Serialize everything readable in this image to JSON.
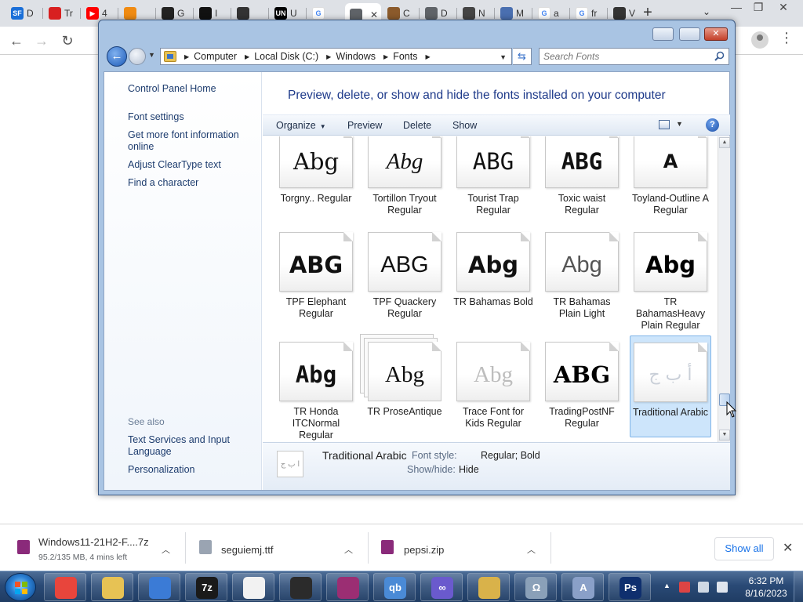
{
  "browser": {
    "tabs": [
      {
        "icon": "sf-favicon",
        "label": "SF",
        "title": "D",
        "color": "#1a6fd8"
      },
      {
        "icon": "red-favicon",
        "label": "",
        "title": "Tr",
        "color": "#d82020"
      },
      {
        "icon": "youtube-favicon",
        "label": "▶",
        "title": "4",
        "color": "#ff0000"
      },
      {
        "icon": "orange-favicon",
        "label": "",
        "title": "",
        "color": "#f08b12"
      },
      {
        "icon": "github-favicon",
        "label": "",
        "title": "G",
        "color": "#222222"
      },
      {
        "icon": "bracket-favicon",
        "label": "",
        "title": "I",
        "color": "#111111"
      },
      {
        "icon": "grid-favicon",
        "label": "",
        "title": "",
        "color": "#333333"
      },
      {
        "icon": "un-favicon",
        "label": "UN",
        "title": "U",
        "color": "#000000"
      },
      {
        "icon": "google-favicon",
        "label": "G",
        "title": "",
        "color": "#ffffff"
      },
      {
        "icon": "globe-favicon",
        "label": "",
        "title": "",
        "color": "#5f6368"
      },
      {
        "icon": "coffee-favicon",
        "label": "",
        "title": "C",
        "color": "#8b5a2b"
      },
      {
        "icon": "globe-favicon-2",
        "label": "",
        "title": "D",
        "color": "#5f6368"
      },
      {
        "icon": "openai-favicon",
        "label": "",
        "title": "N",
        "color": "#444444"
      },
      {
        "icon": "site-favicon",
        "label": "",
        "title": "M",
        "color": "#4a6fb0"
      },
      {
        "icon": "google-favicon-2",
        "label": "G",
        "title": "a",
        "color": "#ffffff"
      },
      {
        "icon": "google-favicon-3",
        "label": "G",
        "title": "fr",
        "color": "#ffffff"
      },
      {
        "icon": "museum-favicon",
        "label": "",
        "title": "V",
        "color": "#333333"
      }
    ],
    "new_tab": "+"
  },
  "explorer": {
    "breadcrumb": [
      "Computer",
      "Local Disk (C:)",
      "Windows",
      "Fonts"
    ],
    "search_placeholder": "Search Fonts",
    "nav_links": {
      "home": "Control Panel Home",
      "font_settings": "Font settings",
      "more_info": "Get more font information online",
      "cleartype": "Adjust ClearType text",
      "find_char": "Find a character"
    },
    "see_also": {
      "label": "See also",
      "text_services": "Text Services and Input Language",
      "personalization": "Personalization"
    },
    "heading": "Preview, delete, or show and hide the fonts installed on your computer",
    "commands": {
      "organize": "Organize",
      "preview": "Preview",
      "delete": "Delete",
      "show": "Show"
    },
    "fonts": [
      {
        "name": "Torgny.. Regular",
        "sample": "Abg",
        "family": "\"DejaVu Serif\", serif",
        "weight": "normal",
        "style": "normal",
        "color": "#111111"
      },
      {
        "name": "Tortillon Tryout Regular",
        "sample": "Abg",
        "family": "\"Liberation Serif\", serif",
        "weight": "normal",
        "style": "italic",
        "color": "#111111"
      },
      {
        "name": "Tourist Trap Regular",
        "sample": "ABG",
        "family": "\"DejaVu Sans Mono\", monospace",
        "weight": "normal",
        "style": "normal",
        "color": "#111111"
      },
      {
        "name": "Toxic waist Regular",
        "sample": "ABG",
        "family": "\"DejaVu Sans Mono\", monospace",
        "weight": "bold",
        "style": "normal",
        "color": "#111111"
      },
      {
        "name": "Toyland-Outline A Regular",
        "sample": "A",
        "family": "\"DejaVu Sans\", sans-serif",
        "weight": "bold",
        "style": "normal",
        "color": "#111111"
      },
      {
        "name": "TPF Elephant Regular",
        "sample": "ABG",
        "family": "\"DejaVu Sans\", sans-serif",
        "weight": "bold",
        "style": "normal",
        "color": "#111111"
      },
      {
        "name": "TPF Quackery Regular",
        "sample": "ABG",
        "family": "\"Liberation Sans\", sans-serif",
        "weight": "normal",
        "style": "normal",
        "color": "#111111"
      },
      {
        "name": "TR Bahamas Bold",
        "sample": "Abg",
        "family": "\"DejaVu Sans\", sans-serif",
        "weight": "bold",
        "style": "normal",
        "color": "#111111"
      },
      {
        "name": "TR Bahamas Plain Light",
        "sample": "Abg",
        "family": "\"Liberation Sans\", sans-serif",
        "weight": "normal",
        "style": "normal",
        "color": "#555555"
      },
      {
        "name": "TR BahamasHeavy Plain Regular",
        "sample": "Abg",
        "family": "\"DejaVu Sans\", sans-serif",
        "weight": "bold",
        "style": "normal",
        "color": "#000000"
      },
      {
        "name": "TR Honda ITCNormal Regular",
        "sample": "Abg",
        "family": "\"DejaVu Sans Mono\", monospace",
        "weight": "bold",
        "style": "normal",
        "color": "#111111"
      },
      {
        "name": "TR ProseAntique",
        "sample": "Abg",
        "family": "\"Liberation Serif\", serif",
        "weight": "normal",
        "style": "normal",
        "color": "#111111"
      },
      {
        "name": "Trace Font for Kids Regular",
        "sample": "Abg",
        "family": "\"Liberation Serif\", serif",
        "weight": "normal",
        "style": "normal",
        "color": "#bdbdbd"
      },
      {
        "name": "TradingPostNF Regular",
        "sample": "ABG",
        "family": "\"DejaVu Serif\", serif",
        "weight": "bold",
        "style": "normal",
        "color": "#000000"
      },
      {
        "name": "Traditional Arabic",
        "sample": "أ ب ج",
        "family": "\"DejaVu Sans\", sans-serif",
        "weight": "normal",
        "style": "normal",
        "color": "#c9cfd8"
      }
    ],
    "details": {
      "name": "Traditional Arabic",
      "thumb_sample": "ا ب ج",
      "style_key": "Font style:",
      "style_val": "Regular; Bold",
      "show_key": "Show/hide:",
      "show_val": "Hide"
    }
  },
  "downloads": {
    "items": [
      {
        "name": "Windows11-21H2-F....7z",
        "status": "95.2/135 MB, 4 mins left",
        "color": "#8a2a7a"
      },
      {
        "name": "seguiemj.ttf",
        "status": "",
        "color": "#9aa4b2"
      },
      {
        "name": "pepsi.zip",
        "status": "",
        "color": "#8a2a7a"
      }
    ],
    "show_all": "Show all"
  },
  "taskbar": {
    "apps": [
      {
        "icon": "chrome-icon",
        "label": "",
        "color": "#e8453c"
      },
      {
        "icon": "file-explorer-icon",
        "label": "",
        "color": "#e7c254"
      },
      {
        "icon": "remote-desktop-icon",
        "label": "",
        "color": "#3b7bd6"
      },
      {
        "icon": "7zip-icon",
        "label": "7z",
        "color": "#1a1a1a"
      },
      {
        "icon": "task-list-icon",
        "label": "",
        "color": "#f2f2f2"
      },
      {
        "icon": "cat-icon",
        "label": "",
        "color": "#2b2b2b"
      },
      {
        "icon": "winrar-icon",
        "label": "",
        "color": "#9b2e73"
      },
      {
        "icon": "qbittorrent-icon",
        "label": "qb",
        "color": "#4a8ad6"
      },
      {
        "icon": "infinity-icon",
        "label": "∞",
        "color": "#6a5acd"
      },
      {
        "icon": "font-folder-icon",
        "label": "",
        "color": "#d9b24a"
      },
      {
        "icon": "font-viewer-icon",
        "label": "Ω",
        "color": "#8aa0b8"
      },
      {
        "icon": "font-editor-icon",
        "label": "A",
        "color": "#8aa0c8"
      },
      {
        "icon": "photoshop-icon",
        "label": "Ps",
        "color": "#0f2f6e"
      }
    ],
    "clock_time": "6:32 PM",
    "clock_date": "8/16/2023"
  }
}
